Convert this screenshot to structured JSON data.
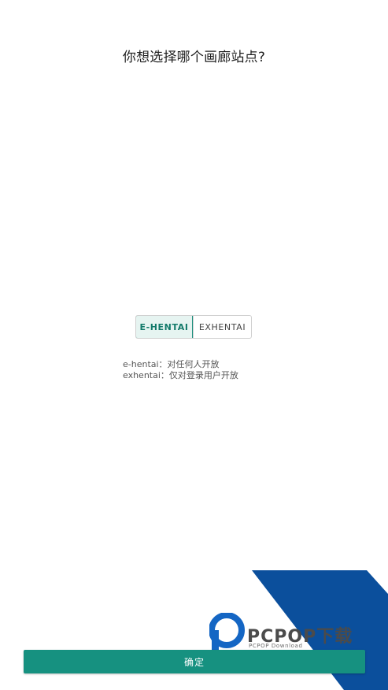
{
  "prompt": {
    "question": "你想选择哪个画廊站点?"
  },
  "site_toggle": {
    "options": [
      {
        "label": "E-HENTAI",
        "selected": true
      },
      {
        "label": "EXHENTAI",
        "selected": false
      }
    ]
  },
  "description": {
    "line1": "e-hentai：对任何人开放",
    "line2": "exhentai：仅对登录用户开放"
  },
  "footer": {
    "confirm_label": "确定"
  },
  "watermark": {
    "brand": "PCPOP下载",
    "subtitle": "PCPOP Download",
    "icon": "pcpop-logo-icon"
  },
  "colors": {
    "accent": "#169180",
    "selected_text": "#127a6a",
    "selected_bg": "#e6f4f1",
    "watermark_blue": "#0b4f9c"
  }
}
